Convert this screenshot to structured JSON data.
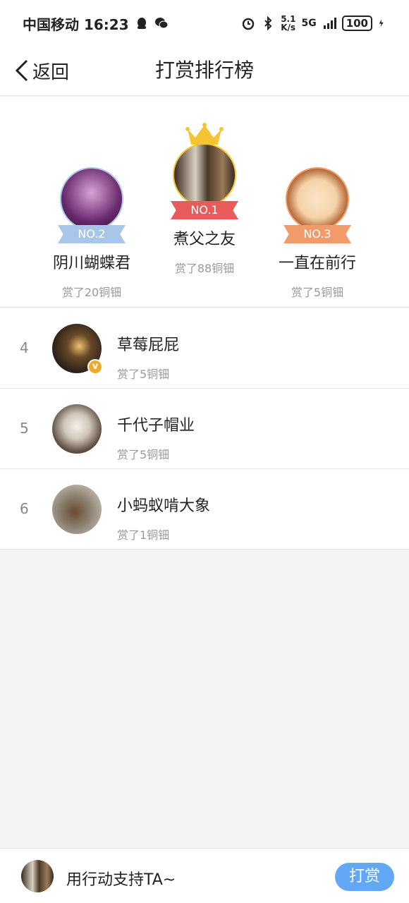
{
  "status_bar": {
    "carrier_time": "中国移动 16:23",
    "net_speed_top": "5.1",
    "net_speed_bottom": "K/s",
    "network": "5G",
    "battery": "100"
  },
  "header": {
    "back_label": "返回",
    "title": "打赏排行榜"
  },
  "podium": [
    {
      "rank_label": "NO.1",
      "name": "煮父之友",
      "amount": "赏了88铜钿",
      "color": "#e95a5a"
    },
    {
      "rank_label": "NO.2",
      "name": "阴川蝴蝶君",
      "amount": "赏了20铜钿",
      "color": "#a7c6e8"
    },
    {
      "rank_label": "NO.3",
      "name": "一直在前行",
      "amount": "赏了5铜钿",
      "color": "#f19a6a"
    }
  ],
  "ranking": [
    {
      "rank": "4",
      "name": "草莓屁屁",
      "amount": "赏了5铜钿"
    },
    {
      "rank": "5",
      "name": "千代子帽业",
      "amount": "赏了5铜钿"
    },
    {
      "rank": "6",
      "name": "小蚂蚁啃大象",
      "amount": "赏了1铜钿"
    }
  ],
  "bottom_bar": {
    "prompt": "用行动支持TA~",
    "tip_button": "打赏"
  },
  "icons": {
    "verified_badge": "v"
  },
  "colors": {
    "accent": "#62a8f5",
    "gold": "#f5c531",
    "first": "#e95a5a",
    "second": "#a7c6e8",
    "third": "#f19a6a"
  }
}
